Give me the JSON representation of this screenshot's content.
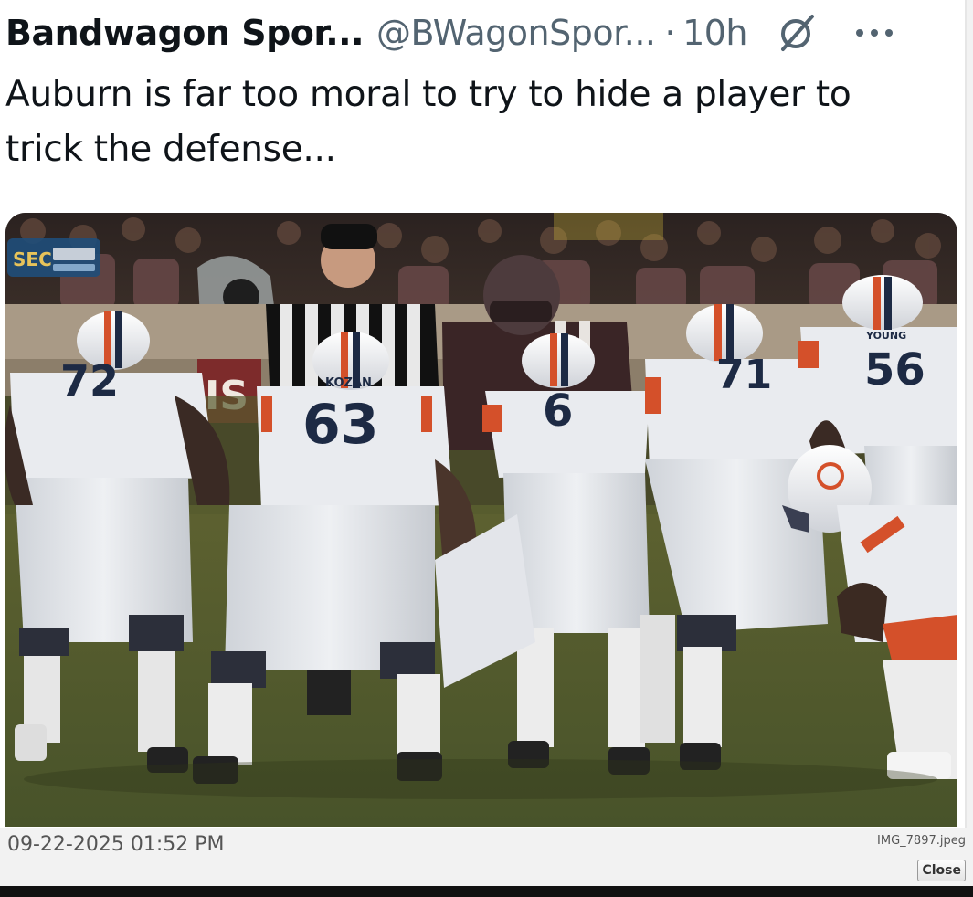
{
  "tweet": {
    "author_name": "Bandwagon Spor...",
    "handle": "@BWagonSpor...",
    "separator": "·",
    "time_ago": "10h",
    "text": "Auburn is far too moral to try to hide a player to trick the defense...",
    "icons": {
      "grok": "grok-slash-icon",
      "more": "more-horizontal-icon"
    },
    "media": {
      "type": "photo",
      "network_bug": "SEC",
      "jersey_numbers": [
        "72",
        "63",
        "6",
        "71",
        "56"
      ],
      "nameplates": [
        "KOZAN",
        "YOUNG"
      ]
    }
  },
  "viewer": {
    "date": "09-22-2025 01:52 PM",
    "filename": "IMG_7897.jpeg",
    "close_label": "Close"
  },
  "colors": {
    "text_primary": "#0f1419",
    "text_secondary": "#536471",
    "field_green": "#4e5a24",
    "jersey_white": "#e9ebef",
    "jersey_navy": "#1d2a44",
    "stripe_orange": "#d4502a"
  }
}
